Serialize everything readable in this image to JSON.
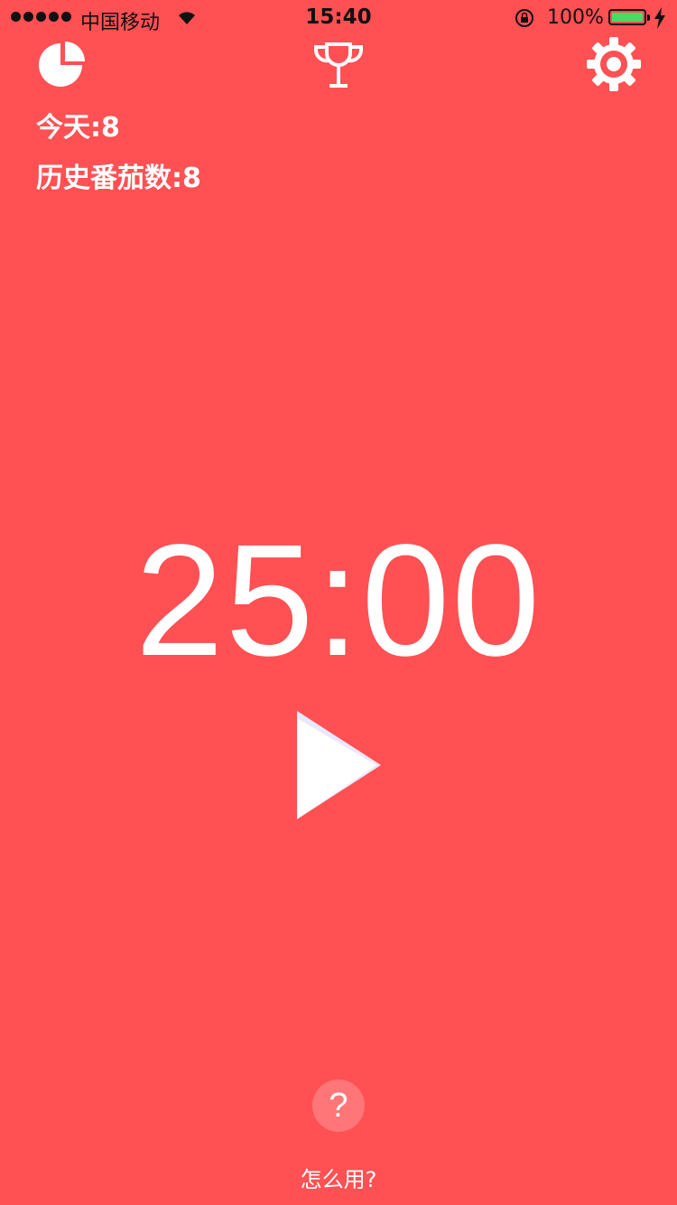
{
  "status_bar": {
    "carrier": "中国移动",
    "time": "15:40",
    "battery_percent": "100%",
    "battery_color": "#4CD964"
  },
  "toolbar": {
    "stats_icon": "pie-chart-icon",
    "achievements_icon": "trophy-icon",
    "settings_icon": "gear-icon"
  },
  "stats": {
    "today": "今天:8",
    "history": "历史番茄数:8"
  },
  "timer": {
    "display": "25:00"
  },
  "controls": {
    "play_icon": "play-icon"
  },
  "help": {
    "icon_text": "?",
    "label": "怎么用?"
  },
  "theme": {
    "background": "#FF5053",
    "foreground": "#FFFFFF"
  }
}
